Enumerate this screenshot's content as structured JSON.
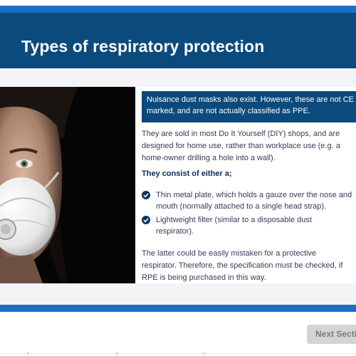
{
  "header": {
    "title": "Types of respiratory protection"
  },
  "notice": {
    "line1": "Nuisance dust masks also exist. However, these are not CE",
    "line2": "marked, and are not actually classified as PPE."
  },
  "intro": {
    "line1": "They are sold in most Do It Yourself (DIY) shops, and are",
    "line2": "designed for home use, rather than workplace use (e.g. a",
    "line3": "home-owner drilling a hole into a wall)."
  },
  "options_heading": "They consist of either a;",
  "options": [
    {
      "line1": "Thin metal plate, which holds a gauze over the nose and",
      "line2": "mouth (normally attached to a single head strap)."
    },
    {
      "line1": "Lightweight filter (similar to a disposable dust",
      "line2": "respirator)."
    }
  ],
  "conclusion": {
    "line1": "The latter could be easily mistaken for a protective",
    "line2": "respirator. Therefore, the specification must be checked, if",
    "line3": "RPE is being purchased in this way."
  },
  "navigation": {
    "next_label": "Next Section"
  },
  "icons": {
    "bullet": "check-circle-icon"
  },
  "colors": {
    "header": "#0b4a7c",
    "accent_strip": "#1c6ec4",
    "notice_bg": "#0b4a7c",
    "body_text": "#3a3a5a",
    "heading_text": "#0b2d55",
    "button_bg": "#d4d4d4"
  }
}
